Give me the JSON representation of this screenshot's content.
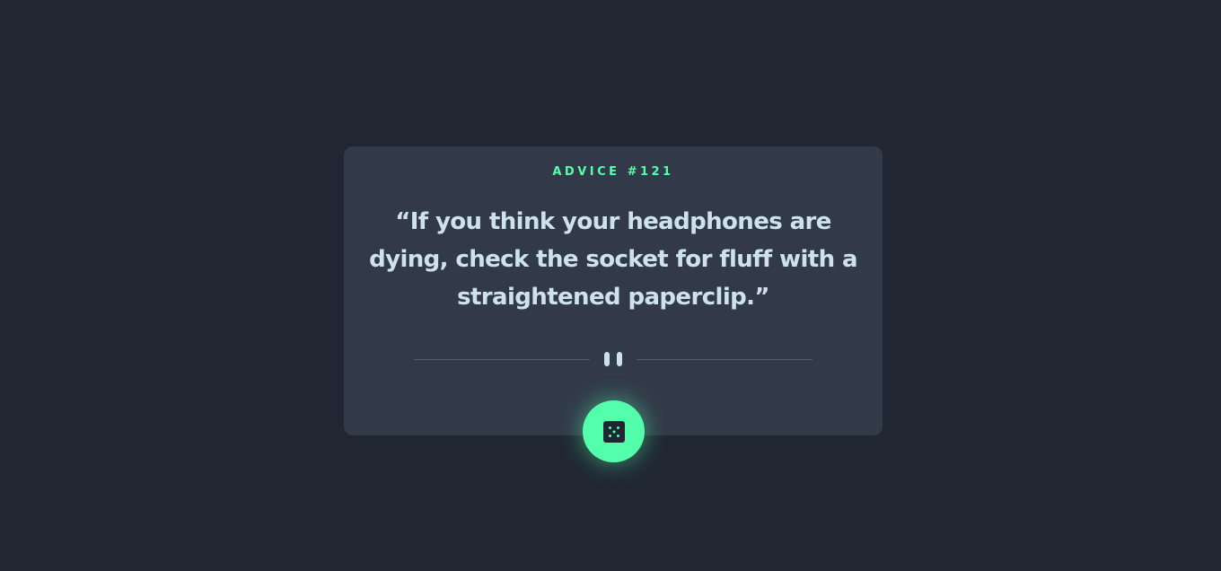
{
  "advice": {
    "label": "ADVICE #121",
    "quote": "“If you think your headphones are dying, check the socket for fluff with a straightened paperclip.”"
  },
  "divider": {
    "icon": "pause-icon"
  },
  "dice_button": {
    "icon": "dice-icon"
  },
  "colors": {
    "background": "#202733",
    "card": "#323a49",
    "accent": "#53ffaa",
    "text": "#cee3e9",
    "divider": "#4f5d74"
  }
}
